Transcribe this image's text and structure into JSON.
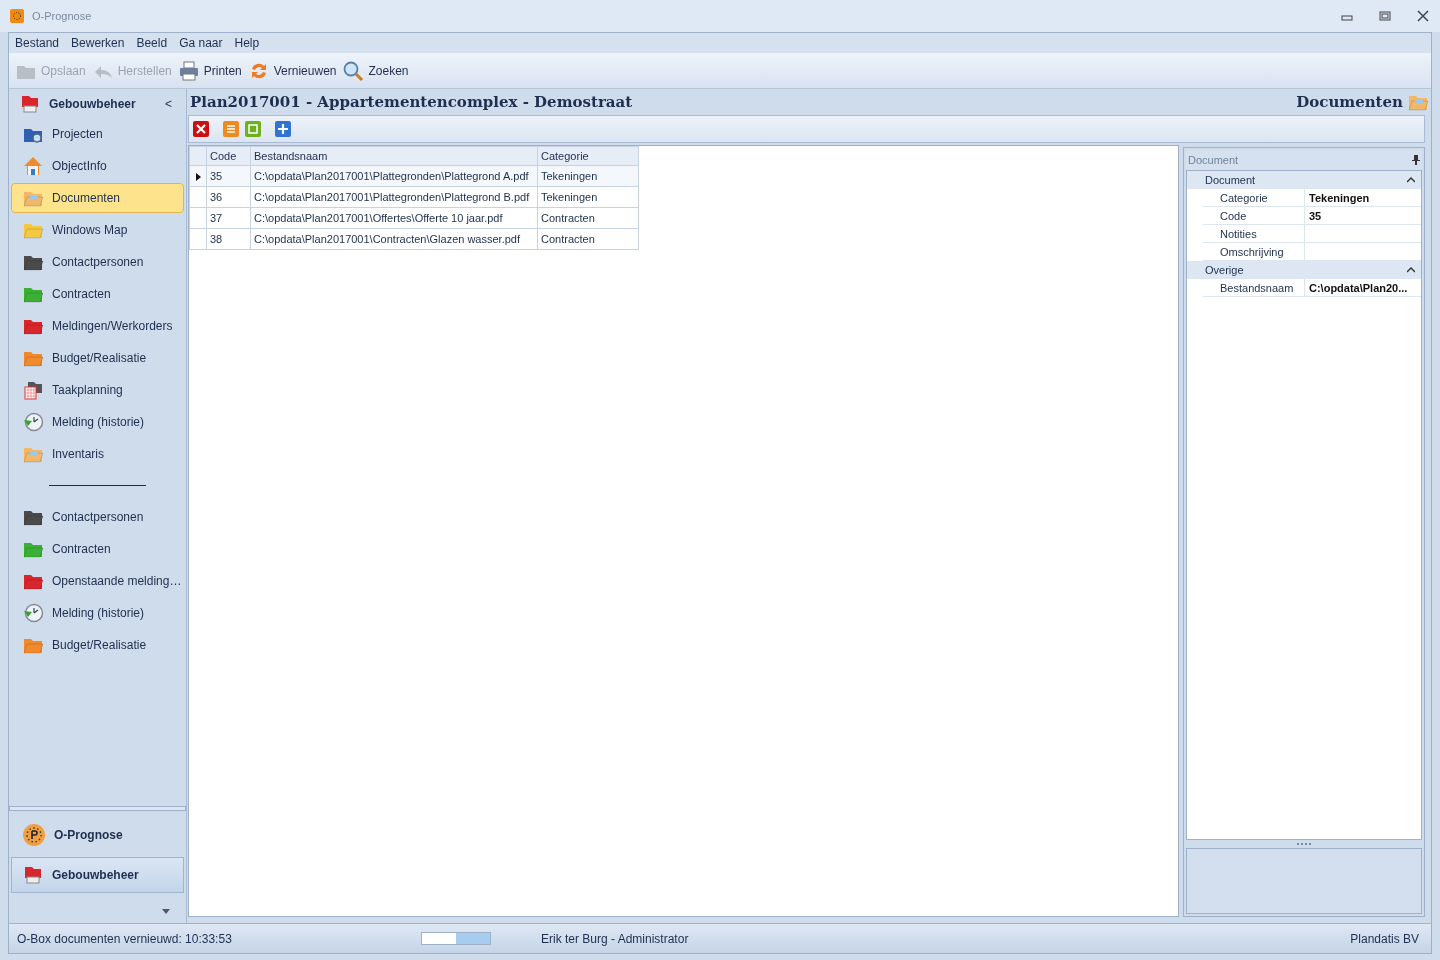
{
  "window": {
    "title": "O-Prognose"
  },
  "menu": [
    "Bestand",
    "Bewerken",
    "Beeld",
    "Ga naar",
    "Help"
  ],
  "toolbar": [
    {
      "label": "Opslaan",
      "kind": "save",
      "disabled": true
    },
    {
      "label": "Herstellen",
      "kind": "undo",
      "disabled": true
    },
    {
      "label": "Printen",
      "kind": "print",
      "disabled": false
    },
    {
      "label": "Vernieuwen",
      "kind": "refresh",
      "disabled": false
    },
    {
      "label": "Zoeken",
      "kind": "search",
      "disabled": false
    }
  ],
  "sidebar": {
    "title": "Gebouwbeheer",
    "collapse": "<",
    "items": [
      {
        "label": "Projecten",
        "kind": "projects",
        "selected": false
      },
      {
        "label": "ObjectInfo",
        "kind": "house",
        "selected": false
      },
      {
        "label": "Documenten",
        "kind": "docs",
        "selected": true
      },
      {
        "label": "Windows Map",
        "kind": "yellow",
        "selected": false
      },
      {
        "label": "Contactpersonen",
        "kind": "dark",
        "selected": false
      },
      {
        "label": "Contracten",
        "kind": "green",
        "selected": false
      },
      {
        "label": "Meldingen/Werkorders",
        "kind": "red",
        "selected": false
      },
      {
        "label": "Budget/Realisatie",
        "kind": "orange",
        "selected": false
      },
      {
        "label": "Taakplanning",
        "kind": "calendar",
        "selected": false
      },
      {
        "label": "Melding (historie)",
        "kind": "clock",
        "selected": false
      },
      {
        "label": "Inventaris",
        "kind": "docs",
        "selected": false
      }
    ],
    "shortcuts": [
      {
        "label": "Contactpersonen",
        "kind": "dark",
        "selected": false
      },
      {
        "label": "Contracten",
        "kind": "green",
        "selected": false
      },
      {
        "label": "Openstaande melding…",
        "kind": "red",
        "selected": false
      },
      {
        "label": "Melding (historie)",
        "kind": "clock",
        "selected": false
      },
      {
        "label": "Budget/Realisatie",
        "kind": "orange",
        "selected": false
      }
    ],
    "modules": [
      {
        "label": "O-Prognose",
        "kind": "prognose",
        "selected": false
      },
      {
        "label": "Gebouwbeheer",
        "kind": "building",
        "selected": true
      }
    ]
  },
  "header": {
    "title": "Plan2017001 - Appartementencomplex - Demostraat",
    "section": "Documenten"
  },
  "table": {
    "columns": [
      "Code",
      "Bestandsnaam",
      "Categorie"
    ],
    "rows": [
      {
        "cells": [
          "35",
          "C:\\opdata\\Plan2017001\\Plattegronden\\Plattegrond A.pdf",
          "Tekeningen"
        ],
        "selected": true
      },
      {
        "cells": [
          "36",
          "C:\\opdata\\Plan2017001\\Plattegronden\\Plattegrond B.pdf",
          "Tekeningen"
        ],
        "selected": false
      },
      {
        "cells": [
          "37",
          "C:\\opdata\\Plan2017001\\Offertes\\Offerte 10 jaar.pdf",
          "Contracten"
        ],
        "selected": false
      },
      {
        "cells": [
          "38",
          "C:\\opdata\\Plan2017001\\Contracten\\Glazen wasser.pdf",
          "Contracten"
        ],
        "selected": false
      }
    ]
  },
  "properties": {
    "title": "Document",
    "groups": [
      {
        "name": "Document",
        "expanded": true,
        "rows": [
          {
            "label": "Categorie",
            "value": "Tekeningen"
          },
          {
            "label": "Code",
            "value": "35"
          },
          {
            "label": "Notities"
          },
          {
            "label": "Omschrijving"
          }
        ]
      },
      {
        "name": "Overige",
        "expanded": true,
        "rows": [
          {
            "label": "Bestandsnaam",
            "value": "C:\\opdata\\Plan20..."
          }
        ]
      }
    ]
  },
  "status_bar": {
    "message": "O-Box documenten vernieuwd: 10:33:53",
    "user": "Erik ter Burg - Administrator",
    "company": "Plandatis BV"
  }
}
